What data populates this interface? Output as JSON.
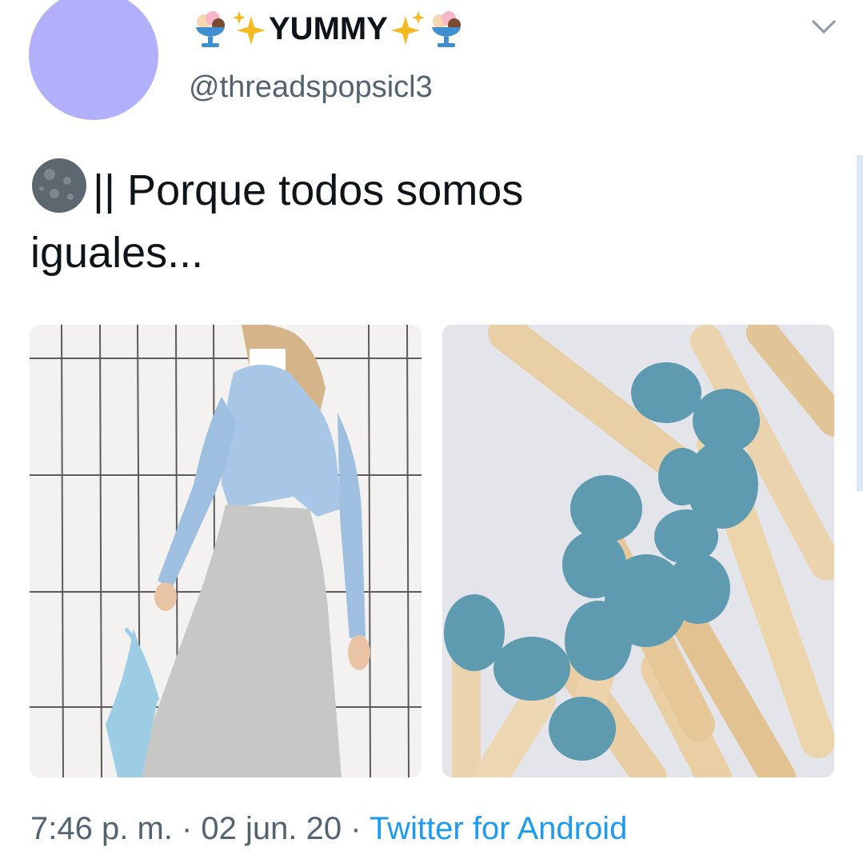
{
  "tweet": {
    "display_name": "YUMMY",
    "handle": "@threadspopsicl3",
    "text_line1": "|| Porque todos somos",
    "text_line2": "iguales...",
    "time": "7:46 p. m.",
    "sep1": " · ",
    "date": "02 jun. 20",
    "sep2": " · ",
    "source": "Twitter for Android"
  },
  "icons": {
    "name_left": [
      "ice-cream-icon",
      "sparkles-icon"
    ],
    "name_right": [
      "sparkles-icon",
      "ice-cream-icon"
    ],
    "text_prefix": "new-moon-icon",
    "menu": "chevron-down-icon"
  },
  "colors": {
    "avatar": "#b3b0fb",
    "link": "#1d9bf0",
    "secondary_text": "#536471",
    "match_head": "#5e9ab0",
    "cardigan": "#a8c7e6"
  },
  "media": [
    {
      "description_name": "outfit-photo"
    },
    {
      "description_name": "matches-photo"
    }
  ]
}
